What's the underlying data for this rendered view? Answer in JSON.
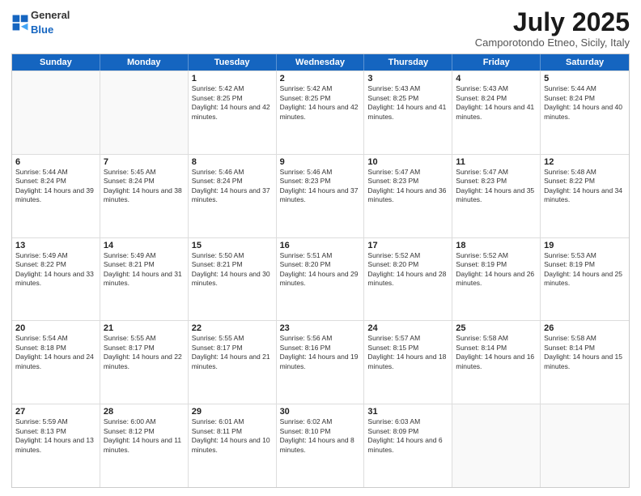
{
  "header": {
    "logo_general": "General",
    "logo_blue": "Blue",
    "title": "July 2025",
    "subtitle": "Camporotondo Etneo, Sicily, Italy"
  },
  "calendar": {
    "days": [
      "Sunday",
      "Monday",
      "Tuesday",
      "Wednesday",
      "Thursday",
      "Friday",
      "Saturday"
    ],
    "rows": [
      [
        {
          "day": "",
          "empty": true
        },
        {
          "day": "",
          "empty": true
        },
        {
          "day": "1",
          "sunrise": "Sunrise: 5:42 AM",
          "sunset": "Sunset: 8:25 PM",
          "daylight": "Daylight: 14 hours and 42 minutes."
        },
        {
          "day": "2",
          "sunrise": "Sunrise: 5:42 AM",
          "sunset": "Sunset: 8:25 PM",
          "daylight": "Daylight: 14 hours and 42 minutes."
        },
        {
          "day": "3",
          "sunrise": "Sunrise: 5:43 AM",
          "sunset": "Sunset: 8:25 PM",
          "daylight": "Daylight: 14 hours and 41 minutes."
        },
        {
          "day": "4",
          "sunrise": "Sunrise: 5:43 AM",
          "sunset": "Sunset: 8:24 PM",
          "daylight": "Daylight: 14 hours and 41 minutes."
        },
        {
          "day": "5",
          "sunrise": "Sunrise: 5:44 AM",
          "sunset": "Sunset: 8:24 PM",
          "daylight": "Daylight: 14 hours and 40 minutes."
        }
      ],
      [
        {
          "day": "6",
          "sunrise": "Sunrise: 5:44 AM",
          "sunset": "Sunset: 8:24 PM",
          "daylight": "Daylight: 14 hours and 39 minutes."
        },
        {
          "day": "7",
          "sunrise": "Sunrise: 5:45 AM",
          "sunset": "Sunset: 8:24 PM",
          "daylight": "Daylight: 14 hours and 38 minutes."
        },
        {
          "day": "8",
          "sunrise": "Sunrise: 5:46 AM",
          "sunset": "Sunset: 8:24 PM",
          "daylight": "Daylight: 14 hours and 37 minutes."
        },
        {
          "day": "9",
          "sunrise": "Sunrise: 5:46 AM",
          "sunset": "Sunset: 8:23 PM",
          "daylight": "Daylight: 14 hours and 37 minutes."
        },
        {
          "day": "10",
          "sunrise": "Sunrise: 5:47 AM",
          "sunset": "Sunset: 8:23 PM",
          "daylight": "Daylight: 14 hours and 36 minutes."
        },
        {
          "day": "11",
          "sunrise": "Sunrise: 5:47 AM",
          "sunset": "Sunset: 8:23 PM",
          "daylight": "Daylight: 14 hours and 35 minutes."
        },
        {
          "day": "12",
          "sunrise": "Sunrise: 5:48 AM",
          "sunset": "Sunset: 8:22 PM",
          "daylight": "Daylight: 14 hours and 34 minutes."
        }
      ],
      [
        {
          "day": "13",
          "sunrise": "Sunrise: 5:49 AM",
          "sunset": "Sunset: 8:22 PM",
          "daylight": "Daylight: 14 hours and 33 minutes."
        },
        {
          "day": "14",
          "sunrise": "Sunrise: 5:49 AM",
          "sunset": "Sunset: 8:21 PM",
          "daylight": "Daylight: 14 hours and 31 minutes."
        },
        {
          "day": "15",
          "sunrise": "Sunrise: 5:50 AM",
          "sunset": "Sunset: 8:21 PM",
          "daylight": "Daylight: 14 hours and 30 minutes."
        },
        {
          "day": "16",
          "sunrise": "Sunrise: 5:51 AM",
          "sunset": "Sunset: 8:20 PM",
          "daylight": "Daylight: 14 hours and 29 minutes."
        },
        {
          "day": "17",
          "sunrise": "Sunrise: 5:52 AM",
          "sunset": "Sunset: 8:20 PM",
          "daylight": "Daylight: 14 hours and 28 minutes."
        },
        {
          "day": "18",
          "sunrise": "Sunrise: 5:52 AM",
          "sunset": "Sunset: 8:19 PM",
          "daylight": "Daylight: 14 hours and 26 minutes."
        },
        {
          "day": "19",
          "sunrise": "Sunrise: 5:53 AM",
          "sunset": "Sunset: 8:19 PM",
          "daylight": "Daylight: 14 hours and 25 minutes."
        }
      ],
      [
        {
          "day": "20",
          "sunrise": "Sunrise: 5:54 AM",
          "sunset": "Sunset: 8:18 PM",
          "daylight": "Daylight: 14 hours and 24 minutes."
        },
        {
          "day": "21",
          "sunrise": "Sunrise: 5:55 AM",
          "sunset": "Sunset: 8:17 PM",
          "daylight": "Daylight: 14 hours and 22 minutes."
        },
        {
          "day": "22",
          "sunrise": "Sunrise: 5:55 AM",
          "sunset": "Sunset: 8:17 PM",
          "daylight": "Daylight: 14 hours and 21 minutes."
        },
        {
          "day": "23",
          "sunrise": "Sunrise: 5:56 AM",
          "sunset": "Sunset: 8:16 PM",
          "daylight": "Daylight: 14 hours and 19 minutes."
        },
        {
          "day": "24",
          "sunrise": "Sunrise: 5:57 AM",
          "sunset": "Sunset: 8:15 PM",
          "daylight": "Daylight: 14 hours and 18 minutes."
        },
        {
          "day": "25",
          "sunrise": "Sunrise: 5:58 AM",
          "sunset": "Sunset: 8:14 PM",
          "daylight": "Daylight: 14 hours and 16 minutes."
        },
        {
          "day": "26",
          "sunrise": "Sunrise: 5:58 AM",
          "sunset": "Sunset: 8:14 PM",
          "daylight": "Daylight: 14 hours and 15 minutes."
        }
      ],
      [
        {
          "day": "27",
          "sunrise": "Sunrise: 5:59 AM",
          "sunset": "Sunset: 8:13 PM",
          "daylight": "Daylight: 14 hours and 13 minutes."
        },
        {
          "day": "28",
          "sunrise": "Sunrise: 6:00 AM",
          "sunset": "Sunset: 8:12 PM",
          "daylight": "Daylight: 14 hours and 11 minutes."
        },
        {
          "day": "29",
          "sunrise": "Sunrise: 6:01 AM",
          "sunset": "Sunset: 8:11 PM",
          "daylight": "Daylight: 14 hours and 10 minutes."
        },
        {
          "day": "30",
          "sunrise": "Sunrise: 6:02 AM",
          "sunset": "Sunset: 8:10 PM",
          "daylight": "Daylight: 14 hours and 8 minutes."
        },
        {
          "day": "31",
          "sunrise": "Sunrise: 6:03 AM",
          "sunset": "Sunset: 8:09 PM",
          "daylight": "Daylight: 14 hours and 6 minutes."
        },
        {
          "day": "",
          "empty": true
        },
        {
          "day": "",
          "empty": true
        }
      ]
    ]
  }
}
